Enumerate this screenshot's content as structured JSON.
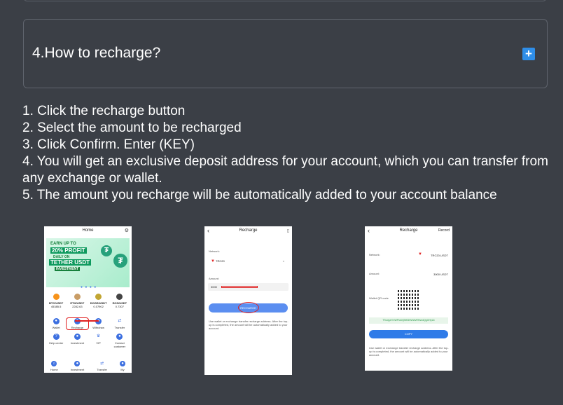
{
  "faq": {
    "title": "4.How to recharge?",
    "expand_icon": "+"
  },
  "steps": [
    "1. Click the recharge button",
    "2. Select the amount to be recharged",
    "3. Click Confirm. Enter (KEY)",
    "4. You will get an exclusive deposit address for your account, which you can transfer from any exchange or wallet.",
    "5. The amount you recharge will be automatically added to your account balance"
  ],
  "phone1": {
    "header": "Home",
    "banner": [
      "EARN UP TO",
      "20% PROFIT",
      "DAILY ON",
      "TETHER USDT",
      "INVESTMENT"
    ],
    "coins": [
      {
        "name": "BTC/USDT",
        "value": "45385.5",
        "color": "#f7931a"
      },
      {
        "name": "ETH/USDT",
        "value": "2282.63",
        "color": "#c99d66"
      },
      {
        "name": "DOGE/USDT",
        "value": "0.07902",
        "color": "#c2a633"
      },
      {
        "name": "EOS/USDT",
        "value": "0.7307",
        "color": "#444444"
      }
    ],
    "actions": [
      "Wallet",
      "Recharge",
      "Withdraw",
      "Transfer",
      "Help center",
      "Investment",
      "VIP",
      "Contact customer"
    ],
    "nav": [
      "Home",
      "Investment",
      "Transfer",
      "My"
    ]
  },
  "phone2": {
    "header": "Recharge",
    "network_label": "Network:",
    "network_value": "TRC20",
    "amount_label": "Amount:",
    "amount_value": "3000",
    "button": "RECHARGE",
    "note": "Use wallet or exchange transfer recharge address. After the top-up is completed, the amount will be automatically added to your account."
  },
  "phone3": {
    "header": "Recharge",
    "record": "Record",
    "network_label": "Network:",
    "network_value": "TRC20-USDT",
    "amount_label": "Amount:",
    "amount_value": "3000 USDT",
    "qr_label": "Wallet QR code",
    "address": "TTcwgzYmWFfoDQMK6HwWvRHsedQgGHyL6",
    "button": "COPY",
    "note": "Use wallet or exchange transfer recharge address. After the top-up is completed, the amount will be automatically added to your account."
  }
}
